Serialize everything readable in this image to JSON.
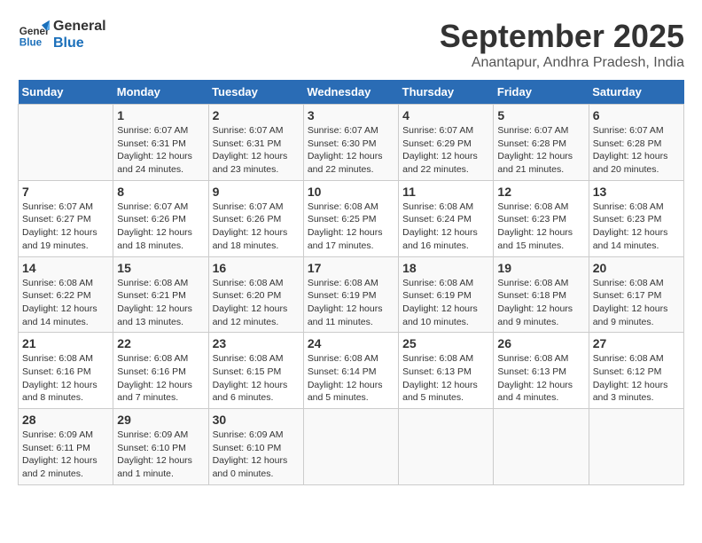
{
  "logo": {
    "line1": "General",
    "line2": "Blue"
  },
  "title": "September 2025",
  "location": "Anantapur, Andhra Pradesh, India",
  "days_header": [
    "Sunday",
    "Monday",
    "Tuesday",
    "Wednesday",
    "Thursday",
    "Friday",
    "Saturday"
  ],
  "weeks": [
    [
      {
        "day": "",
        "info": ""
      },
      {
        "day": "1",
        "info": "Sunrise: 6:07 AM\nSunset: 6:31 PM\nDaylight: 12 hours\nand 24 minutes."
      },
      {
        "day": "2",
        "info": "Sunrise: 6:07 AM\nSunset: 6:31 PM\nDaylight: 12 hours\nand 23 minutes."
      },
      {
        "day": "3",
        "info": "Sunrise: 6:07 AM\nSunset: 6:30 PM\nDaylight: 12 hours\nand 22 minutes."
      },
      {
        "day": "4",
        "info": "Sunrise: 6:07 AM\nSunset: 6:29 PM\nDaylight: 12 hours\nand 22 minutes."
      },
      {
        "day": "5",
        "info": "Sunrise: 6:07 AM\nSunset: 6:28 PM\nDaylight: 12 hours\nand 21 minutes."
      },
      {
        "day": "6",
        "info": "Sunrise: 6:07 AM\nSunset: 6:28 PM\nDaylight: 12 hours\nand 20 minutes."
      }
    ],
    [
      {
        "day": "7",
        "info": "Sunrise: 6:07 AM\nSunset: 6:27 PM\nDaylight: 12 hours\nand 19 minutes."
      },
      {
        "day": "8",
        "info": "Sunrise: 6:07 AM\nSunset: 6:26 PM\nDaylight: 12 hours\nand 18 minutes."
      },
      {
        "day": "9",
        "info": "Sunrise: 6:07 AM\nSunset: 6:26 PM\nDaylight: 12 hours\nand 18 minutes."
      },
      {
        "day": "10",
        "info": "Sunrise: 6:08 AM\nSunset: 6:25 PM\nDaylight: 12 hours\nand 17 minutes."
      },
      {
        "day": "11",
        "info": "Sunrise: 6:08 AM\nSunset: 6:24 PM\nDaylight: 12 hours\nand 16 minutes."
      },
      {
        "day": "12",
        "info": "Sunrise: 6:08 AM\nSunset: 6:23 PM\nDaylight: 12 hours\nand 15 minutes."
      },
      {
        "day": "13",
        "info": "Sunrise: 6:08 AM\nSunset: 6:23 PM\nDaylight: 12 hours\nand 14 minutes."
      }
    ],
    [
      {
        "day": "14",
        "info": "Sunrise: 6:08 AM\nSunset: 6:22 PM\nDaylight: 12 hours\nand 14 minutes."
      },
      {
        "day": "15",
        "info": "Sunrise: 6:08 AM\nSunset: 6:21 PM\nDaylight: 12 hours\nand 13 minutes."
      },
      {
        "day": "16",
        "info": "Sunrise: 6:08 AM\nSunset: 6:20 PM\nDaylight: 12 hours\nand 12 minutes."
      },
      {
        "day": "17",
        "info": "Sunrise: 6:08 AM\nSunset: 6:19 PM\nDaylight: 12 hours\nand 11 minutes."
      },
      {
        "day": "18",
        "info": "Sunrise: 6:08 AM\nSunset: 6:19 PM\nDaylight: 12 hours\nand 10 minutes."
      },
      {
        "day": "19",
        "info": "Sunrise: 6:08 AM\nSunset: 6:18 PM\nDaylight: 12 hours\nand 9 minutes."
      },
      {
        "day": "20",
        "info": "Sunrise: 6:08 AM\nSunset: 6:17 PM\nDaylight: 12 hours\nand 9 minutes."
      }
    ],
    [
      {
        "day": "21",
        "info": "Sunrise: 6:08 AM\nSunset: 6:16 PM\nDaylight: 12 hours\nand 8 minutes."
      },
      {
        "day": "22",
        "info": "Sunrise: 6:08 AM\nSunset: 6:16 PM\nDaylight: 12 hours\nand 7 minutes."
      },
      {
        "day": "23",
        "info": "Sunrise: 6:08 AM\nSunset: 6:15 PM\nDaylight: 12 hours\nand 6 minutes."
      },
      {
        "day": "24",
        "info": "Sunrise: 6:08 AM\nSunset: 6:14 PM\nDaylight: 12 hours\nand 5 minutes."
      },
      {
        "day": "25",
        "info": "Sunrise: 6:08 AM\nSunset: 6:13 PM\nDaylight: 12 hours\nand 5 minutes."
      },
      {
        "day": "26",
        "info": "Sunrise: 6:08 AM\nSunset: 6:13 PM\nDaylight: 12 hours\nand 4 minutes."
      },
      {
        "day": "27",
        "info": "Sunrise: 6:08 AM\nSunset: 6:12 PM\nDaylight: 12 hours\nand 3 minutes."
      }
    ],
    [
      {
        "day": "28",
        "info": "Sunrise: 6:09 AM\nSunset: 6:11 PM\nDaylight: 12 hours\nand 2 minutes."
      },
      {
        "day": "29",
        "info": "Sunrise: 6:09 AM\nSunset: 6:10 PM\nDaylight: 12 hours\nand 1 minute."
      },
      {
        "day": "30",
        "info": "Sunrise: 6:09 AM\nSunset: 6:10 PM\nDaylight: 12 hours\nand 0 minutes."
      },
      {
        "day": "",
        "info": ""
      },
      {
        "day": "",
        "info": ""
      },
      {
        "day": "",
        "info": ""
      },
      {
        "day": "",
        "info": ""
      }
    ]
  ]
}
